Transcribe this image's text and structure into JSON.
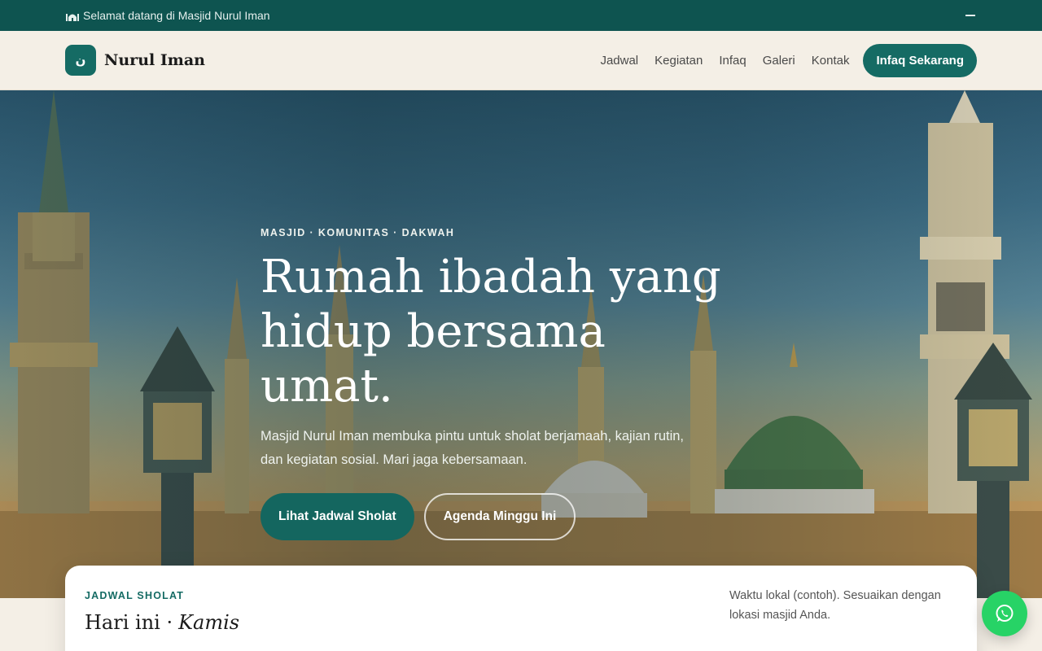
{
  "topbar": {
    "icon": "mosque-icon",
    "welcome": "Selamat datang di Masjid Nurul Iman",
    "toggle_icon": "minus-icon"
  },
  "header": {
    "logo_glyph": "ن",
    "brand": "Nurul Iman",
    "nav": [
      "Jadwal",
      "Kegiatan",
      "Infaq",
      "Galeri",
      "Kontak"
    ],
    "cta": "Infaq Sekarang"
  },
  "hero": {
    "eyebrow": "MASJID · KOMUNITAS · DAKWAH",
    "title": "Rumah ibadah yang hidup bersama umat.",
    "lede": "Masjid Nurul Iman membuka pintu untuk sholat berjamaah, kajian rutin, dan kegiatan sosial. Mari jaga kebersamaan.",
    "primary_button": "Lihat Jadwal Sholat",
    "secondary_button": "Agenda Minggu Ini"
  },
  "schedule": {
    "label": "JADWAL SHOLAT",
    "heading_prefix": "Hari ini ·",
    "day": "Kamis",
    "note": "Waktu lokal (contoh). Sesuaikan dengan lokasi masjid Anda."
  },
  "floating": {
    "icon": "whatsapp-icon"
  },
  "colors": {
    "primary": "#156b64",
    "topbar": "#0e5450",
    "background": "#f4efe6",
    "whatsapp": "#27d366"
  }
}
